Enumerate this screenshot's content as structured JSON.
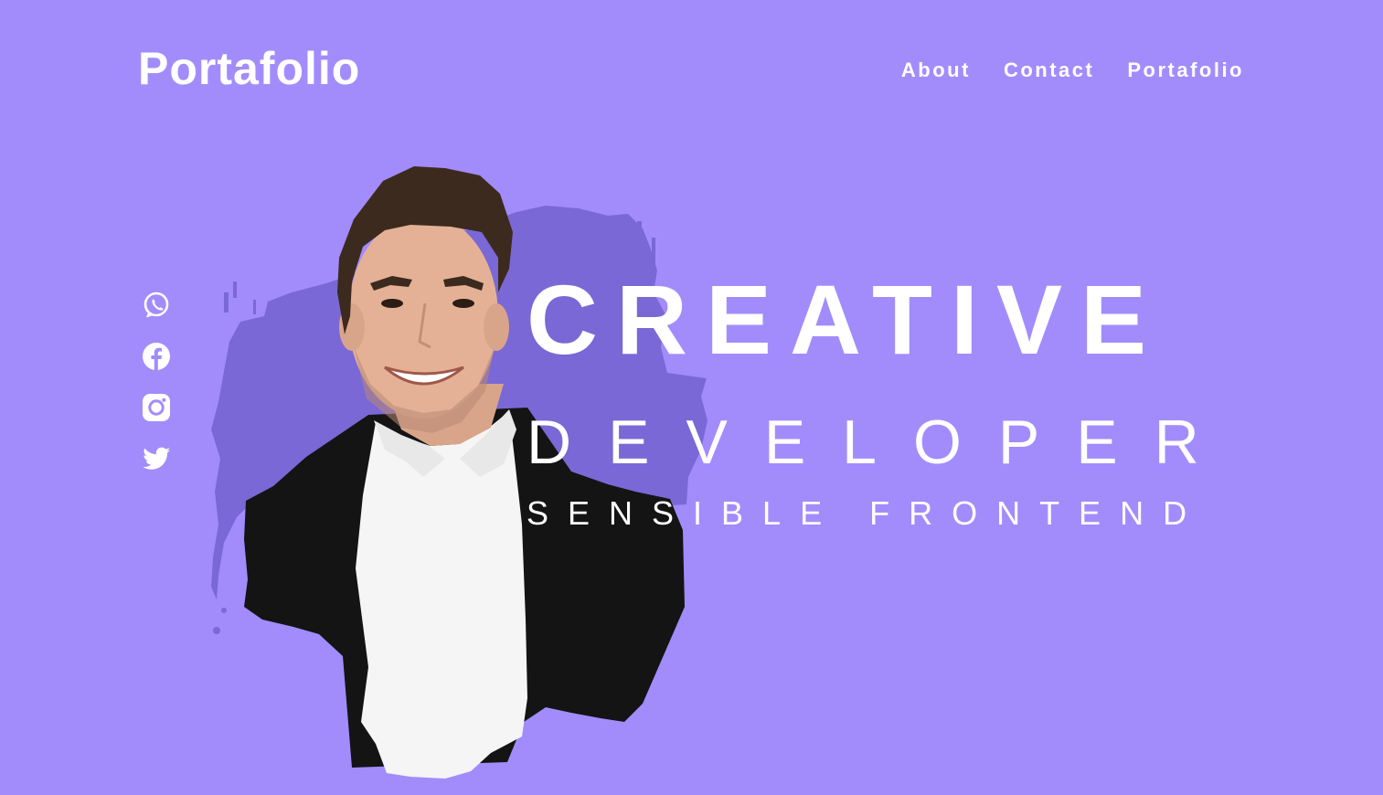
{
  "brand": {
    "title": "Portafolio"
  },
  "nav": {
    "items": [
      {
        "label": "About"
      },
      {
        "label": "Contact"
      },
      {
        "label": "Portafolio"
      }
    ]
  },
  "socials": [
    {
      "icon": "whatsapp-icon"
    },
    {
      "icon": "facebook-icon"
    },
    {
      "icon": "instagram-icon"
    },
    {
      "icon": "twitter-icon"
    }
  ],
  "hero": {
    "line1": "CREATIVE",
    "line2": "DEVELOPER",
    "line3": "SENSIBLE FRONTEND"
  },
  "colors": {
    "background": "#a28cfc",
    "brush": "#7a68d6",
    "text": "#ffffff",
    "jacket": "#141414",
    "shirt": "#f5f5f5",
    "skin": "#e4b197",
    "hair": "#3c2a1e"
  }
}
